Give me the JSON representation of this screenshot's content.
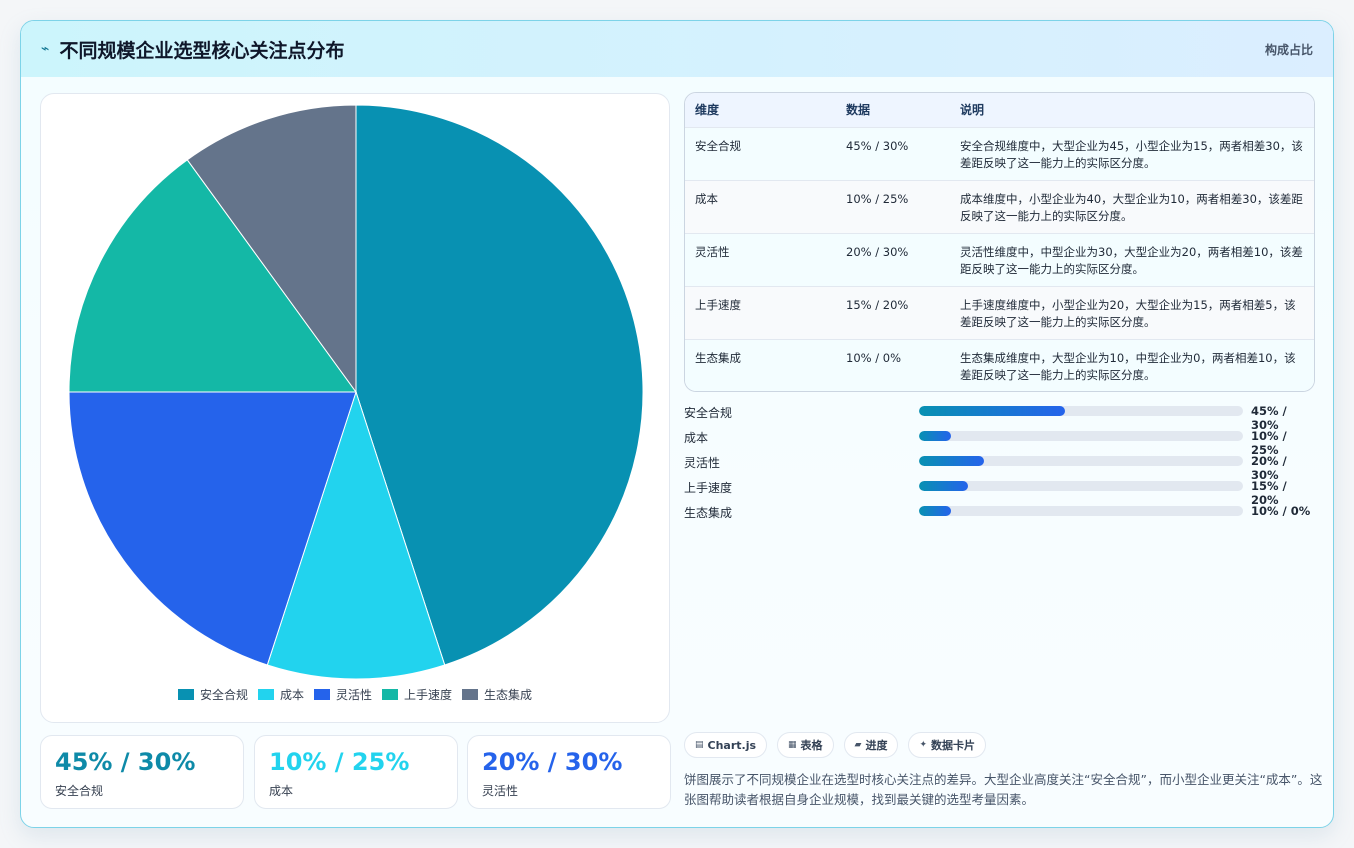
{
  "header": {
    "icon": "⌁",
    "title": "不同规模企业选型核心关注点分布",
    "subtitle": "构成占比"
  },
  "chart_data": {
    "type": "pie",
    "categories": [
      "安全合规",
      "成本",
      "灵活性",
      "上手速度",
      "生态集成"
    ],
    "values": [
      45,
      10,
      20,
      15,
      10
    ],
    "colors": [
      "#0891b2",
      "#22d3ee",
      "#2563eb",
      "#14b8a6",
      "#64748b"
    ],
    "legend_position": "bottom"
  },
  "stats": [
    {
      "value": "45% / 30%",
      "label": "安全合规",
      "color": "#0e8aa8"
    },
    {
      "value": "10% / 25%",
      "label": "成本",
      "color": "#22d3ee"
    },
    {
      "value": "20% / 30%",
      "label": "灵活性",
      "color": "#2563eb"
    }
  ],
  "table": {
    "headers": [
      "维度",
      "数据",
      "说明"
    ],
    "rows": [
      {
        "dim": "安全合规",
        "data": "45% / 30%",
        "note": "安全合规维度中，大型企业为45，小型企业为15，两者相差30，该差距反映了这一能力上的实际区分度。"
      },
      {
        "dim": "成本",
        "data": "10% / 25%",
        "note": "成本维度中，小型企业为40，大型企业为10，两者相差30，该差距反映了这一能力上的实际区分度。"
      },
      {
        "dim": "灵活性",
        "data": "20% / 30%",
        "note": "灵活性维度中，中型企业为30，大型企业为20，两者相差10，该差距反映了这一能力上的实际区分度。"
      },
      {
        "dim": "上手速度",
        "data": "15% / 20%",
        "note": "上手速度维度中，小型企业为20，大型企业为15，两者相差5，该差距反映了这一能力上的实际区分度。"
      },
      {
        "dim": "生态集成",
        "data": "10% / 0%",
        "note": "生态集成维度中，大型企业为10，中型企业为0，两者相差10，该差距反映了这一能力上的实际区分度。"
      }
    ]
  },
  "progress": [
    {
      "label": "安全合规",
      "value_text": "45% / 30%",
      "fill": 0.45
    },
    {
      "label": "成本",
      "value_text": "10% / 25%",
      "fill": 0.1
    },
    {
      "label": "灵活性",
      "value_text": "20% / 30%",
      "fill": 0.2
    },
    {
      "label": "上手速度",
      "value_text": "15% / 20%",
      "fill": 0.15
    },
    {
      "label": "生态集成",
      "value_text": "10% / 0%",
      "fill": 0.1
    }
  ],
  "tags": [
    {
      "icon": "▤",
      "label": "Chart.js"
    },
    {
      "icon": "▦",
      "label": "表格"
    },
    {
      "icon": "▰",
      "label": "进度"
    },
    {
      "icon": "✦",
      "label": "数据卡片"
    }
  ],
  "description": "饼图展示了不同规模企业在选型时核心关注点的差异。大型企业高度关注“安全合规”，而小型企业更关注“成本”。这张图帮助读者根据自身企业规模，找到最关键的选型考量因素。"
}
